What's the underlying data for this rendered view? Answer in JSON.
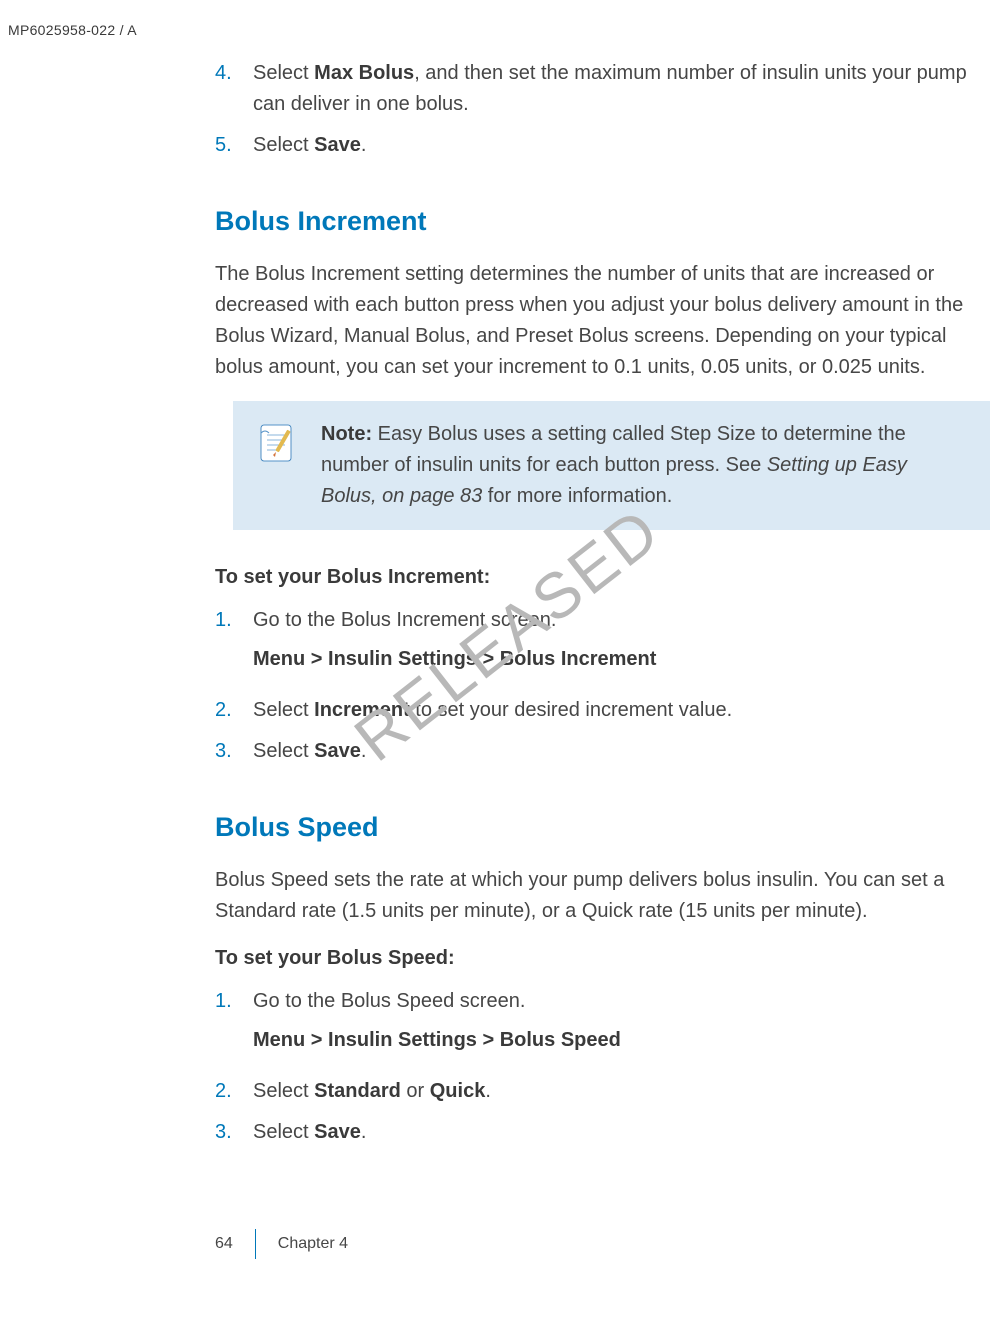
{
  "header": {
    "doc_id": "MP6025958-022 / A"
  },
  "intro_steps": [
    {
      "num": "4.",
      "pre": "Select ",
      "bold": "Max Bolus",
      "post": ", and then set the maximum number of insulin units your pump can deliver in one bolus."
    },
    {
      "num": "5.",
      "pre": "Select ",
      "bold": "Save",
      "post": "."
    }
  ],
  "section1": {
    "title": "Bolus Increment",
    "para": "The Bolus Increment setting determines the number of units that are increased or decreased with each button press when you adjust your bolus delivery amount in the Bolus Wizard, Manual Bolus, and Preset Bolus screens. Depending on your typical bolus amount, you can set your increment to 0.1 units, 0.05 units, or 0.025 units.",
    "note": {
      "label": "Note:",
      "text1": "  Easy Bolus uses a setting called Step Size to determine the number of insulin units for each button press. See ",
      "italic": "Setting up Easy Bolus, on page 83",
      "text2": " for more information."
    },
    "subhead": "To set your Bolus Increment:",
    "steps": [
      {
        "num": "1.",
        "pre": "Go to the Bolus Increment screen.",
        "bold": "",
        "post": "",
        "breadcrumb": "Menu > Insulin Settings > Bolus Increment"
      },
      {
        "num": "2.",
        "pre": "Select ",
        "bold": "Increment",
        "post": " to set your desired increment value."
      },
      {
        "num": "3.",
        "pre": "Select ",
        "bold": "Save",
        "post": "."
      }
    ]
  },
  "section2": {
    "title": "Bolus Speed",
    "para": "Bolus Speed sets the rate at which your pump delivers bolus insulin. You can set a Standard rate (1.5 units per minute), or a Quick rate (15 units per minute).",
    "subhead": "To set your Bolus Speed:",
    "steps": [
      {
        "num": "1.",
        "pre": "Go to the Bolus Speed screen.",
        "bold": "",
        "post": "",
        "breadcrumb": "Menu > Insulin Settings > Bolus Speed"
      },
      {
        "num": "2.",
        "pre": "Select ",
        "bold": "Standard",
        "mid": " or ",
        "bold2": "Quick",
        "post": "."
      },
      {
        "num": "3.",
        "pre": "Select ",
        "bold": "Save",
        "post": "."
      }
    ]
  },
  "watermark": "RELEASED",
  "footer": {
    "page": "64",
    "chapter": "Chapter 4"
  }
}
